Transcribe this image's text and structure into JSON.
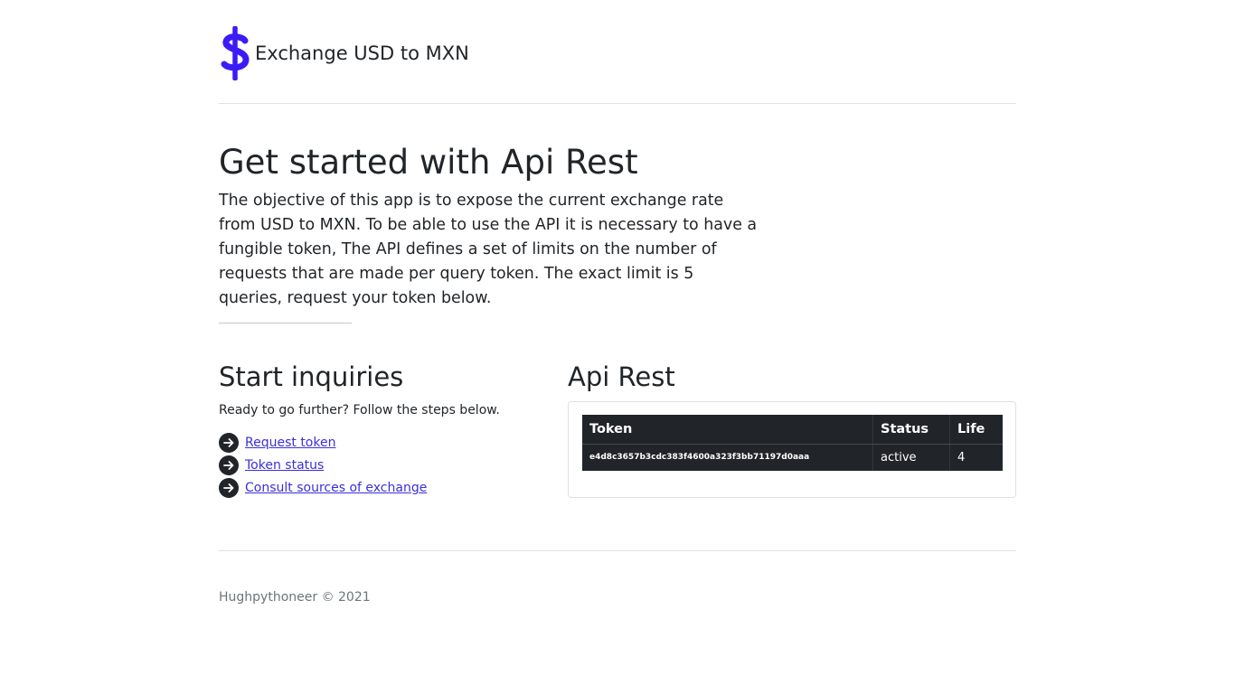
{
  "header": {
    "title": "Exchange USD to MXN",
    "icon": "dollar-sign-icon",
    "accent_color": "#3b1cf5"
  },
  "intro": {
    "heading": "Get started with Api Rest",
    "description": "The objective of this app is to expose the current exchange rate from USD to MXN. To be able to use the API it is necessary to have a fungible token, The API defines a set of limits on the number of requests that are made per query token. The exact limit is 5 queries, request your token below."
  },
  "inquiries": {
    "heading": "Start inquiries",
    "subtitle": "Ready to go further? Follow the steps below.",
    "links": [
      {
        "label": "Request token",
        "icon": "arrow-right-circle-icon"
      },
      {
        "label": "Token status",
        "icon": "arrow-right-circle-icon"
      },
      {
        "label": "Consult sources of exchange",
        "icon": "arrow-right-circle-icon"
      }
    ]
  },
  "api": {
    "heading": "Api Rest",
    "table": {
      "columns": [
        "Token",
        "Status",
        "Life"
      ],
      "rows": [
        [
          "e4d8c3657b3cdc383f4600a323f3bb71197d0aaa",
          "active",
          "4"
        ]
      ]
    }
  },
  "footer": {
    "text": "Hughpythoneer © 2021"
  }
}
